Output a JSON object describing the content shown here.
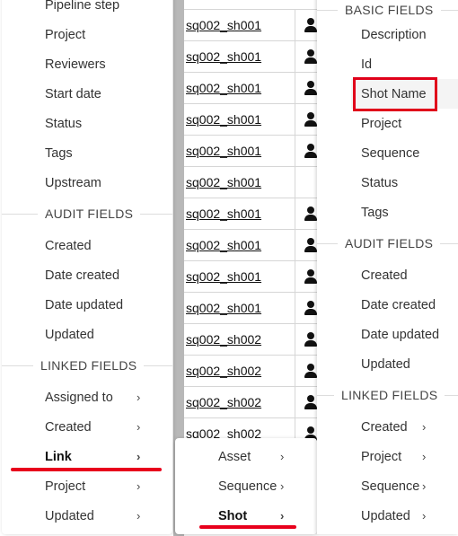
{
  "table": {
    "rows": [
      {
        "name": "sq002_sh001",
        "icon": "person-icon"
      },
      {
        "name": "sq002_sh001",
        "icon": "person-icon"
      },
      {
        "name": "sq002_sh001",
        "icon": "person-icon"
      },
      {
        "name": "sq002_sh001",
        "icon": "person-icon"
      },
      {
        "name": "sq002_sh001",
        "icon": "person-icon"
      },
      {
        "name": "sq002_sh001",
        "icon": ""
      },
      {
        "name": "sq002_sh001",
        "icon": "person-icon"
      },
      {
        "name": "sq002_sh001",
        "icon": "person-icon"
      },
      {
        "name": "sq002_sh001",
        "icon": "person-icon"
      },
      {
        "name": "sq002_sh001",
        "icon": "person-icon"
      },
      {
        "name": "sq002_sh002",
        "icon": "person-icon"
      },
      {
        "name": "sq002_sh002",
        "icon": "person-icon"
      },
      {
        "name": "sq002_sh002",
        "icon": "person-icon"
      },
      {
        "name": "sq002_sh002",
        "icon": "person-icon"
      }
    ]
  },
  "left_menu": {
    "top_items": [
      "Pipeline step",
      "Project",
      "Reviewers",
      "Start date",
      "Status",
      "Tags",
      "Upstream"
    ],
    "audit_header": "AUDIT FIELDS",
    "audit_items": [
      "Created",
      "Date created",
      "Date updated",
      "Updated"
    ],
    "linked_header": "LINKED FIELDS",
    "linked_items": [
      {
        "label": "Assigned to",
        "chevron": "›"
      },
      {
        "label": "Created",
        "chevron": "›"
      },
      {
        "label": "Link",
        "chevron": "›"
      },
      {
        "label": "Project",
        "chevron": "›"
      },
      {
        "label": "Updated",
        "chevron": "›"
      }
    ]
  },
  "sub_menu": {
    "items": [
      {
        "label": "Asset",
        "chevron": "›"
      },
      {
        "label": "Sequence",
        "chevron": "›"
      },
      {
        "label": "Shot",
        "chevron": "›"
      }
    ]
  },
  "right_menu": {
    "basic_header": "BASIC FIELDS",
    "basic_items": [
      "Description",
      "Id",
      "Shot Name",
      "Project",
      "Sequence",
      "Status",
      "Tags"
    ],
    "audit_header": "AUDIT FIELDS",
    "audit_items": [
      "Created",
      "Date created",
      "Date updated",
      "Updated"
    ],
    "linked_header": "LINKED FIELDS",
    "linked_items": [
      {
        "label": "Created",
        "chevron": "›"
      },
      {
        "label": "Project",
        "chevron": "›"
      },
      {
        "label": "Sequence",
        "chevron": "›"
      },
      {
        "label": "Updated",
        "chevron": "›"
      }
    ]
  },
  "colors": {
    "annotation": "#e0001a"
  }
}
